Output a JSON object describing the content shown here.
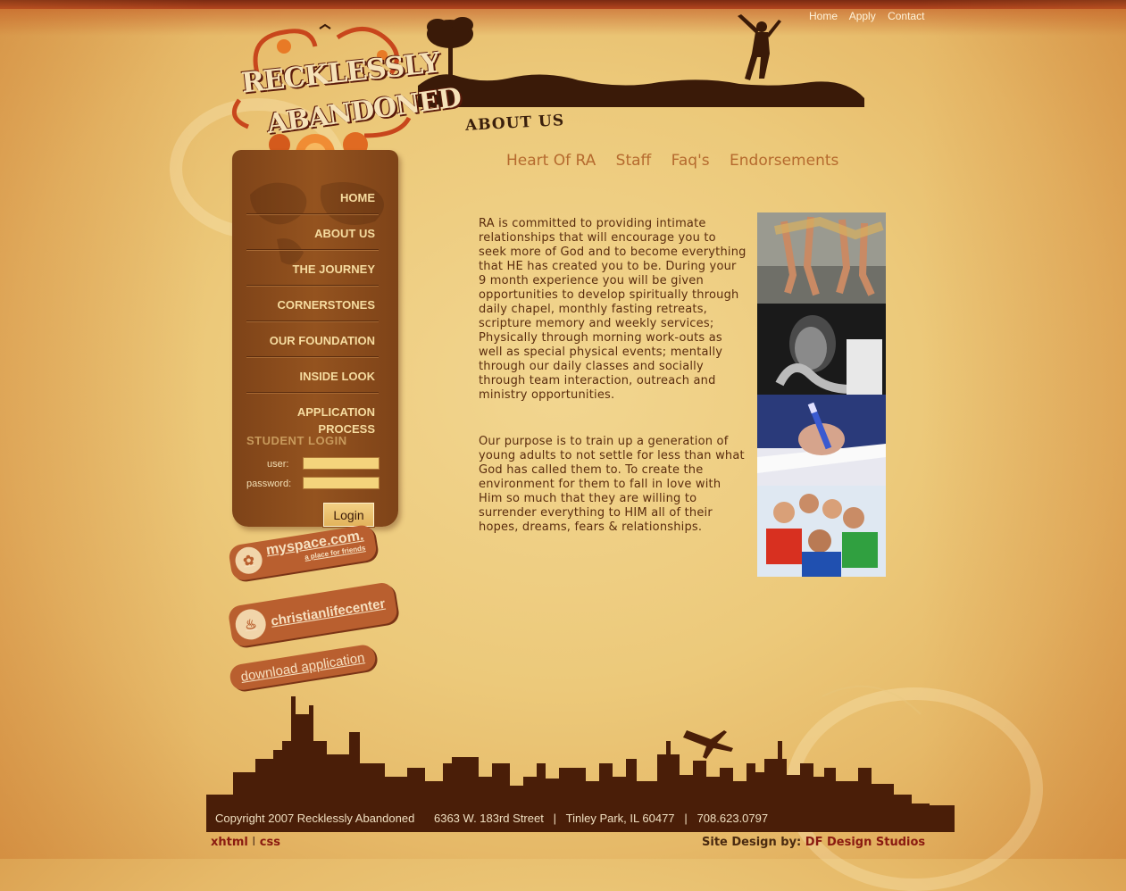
{
  "top_links": [
    "Home",
    "Apply",
    "Contact"
  ],
  "logo": {
    "line1": "RECKLESSLY",
    "line2": "ABANDONED"
  },
  "sidebar": {
    "nav": [
      {
        "label": "HOME"
      },
      {
        "label": "ABOUT US"
      },
      {
        "label": "THE JOURNEY"
      },
      {
        "label": "CORNERSTONES"
      },
      {
        "label": "OUR FOUNDATION"
      },
      {
        "label": "INSIDE LOOK"
      },
      {
        "label": "APPLICATION PROCESS"
      }
    ],
    "login": {
      "heading": "STUDENT LOGIN",
      "user_label": "user:",
      "password_label": "password:",
      "button": "Login"
    }
  },
  "badges": {
    "myspace_main": "myspace.com.",
    "myspace_sub": "a place for friends",
    "clc": "christianlifecenter",
    "download": "download application"
  },
  "main": {
    "heading": "ABOUT US",
    "subnav": [
      "Heart Of RA",
      "Staff",
      "Faq's",
      "Endorsements"
    ],
    "paragraph1": "RA is committed to providing intimate relationships that will encourage you to seek more of God and to become everything that HE has created you to be. During your 9 month experience you will be given opportunities to develop spiritually through daily chapel, monthly fasting retreats, scripture memory and weekly services; Physically through morning work-outs as well as special physical events; mentally through our daily classes and socially through team interaction, outreach and ministry opportunities.",
    "paragraph2": "Our purpose is to train up a generation of young adults to not settle for less than what God has called them to. To create the environment for them to fall in love with Him so much that they are willing to surrender everything to HIM all of their hopes, dreams, fears & relationships."
  },
  "footer": {
    "address": "Copyright 2007 Recklessly Abandoned      6363 W. 183rd Street   |   Tinley Park, IL 60477   |   708.623.0797",
    "xhtml": "xhtml",
    "separator": "I",
    "css": "css",
    "credit_label": "Site Design by:",
    "credit_name": "DF Design Studios"
  },
  "colors": {
    "background": "#ecc97a",
    "sidebar": "#8a4a1c",
    "nav_text": "#f6dca0",
    "subnav_link": "#b56a2e",
    "body_text": "#5a2c0e",
    "footer_link": "#8a1a10"
  }
}
